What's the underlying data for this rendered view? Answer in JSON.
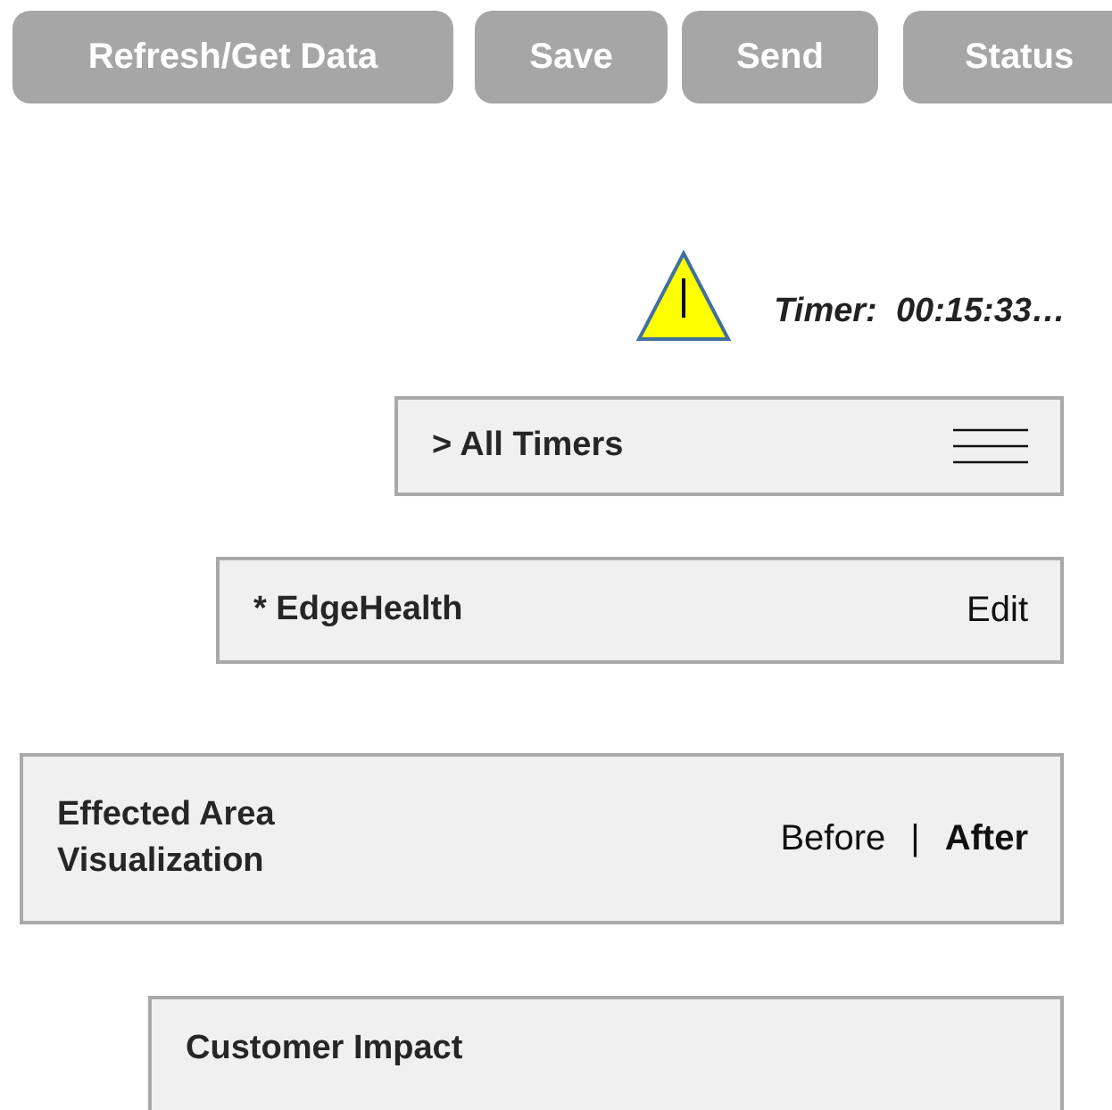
{
  "toolbar": {
    "buttons": [
      "Refresh/Get Data",
      "Save",
      "Send",
      "Status"
    ]
  },
  "timer": {
    "label": "Timer:  00:15:33…",
    "warning": true
  },
  "panels": [
    {
      "kind": "menu",
      "title": "> All Timers"
    },
    {
      "kind": "action",
      "title": "* EdgeHealth",
      "action": "Edit"
    },
    {
      "kind": "toggle",
      "title": "Effected Area Visualization",
      "separator": "|",
      "options": [
        {
          "label": "Before",
          "selected": false
        },
        {
          "label": "After",
          "selected": true
        }
      ]
    },
    {
      "kind": "plain",
      "title": "Customer Impact"
    }
  ]
}
